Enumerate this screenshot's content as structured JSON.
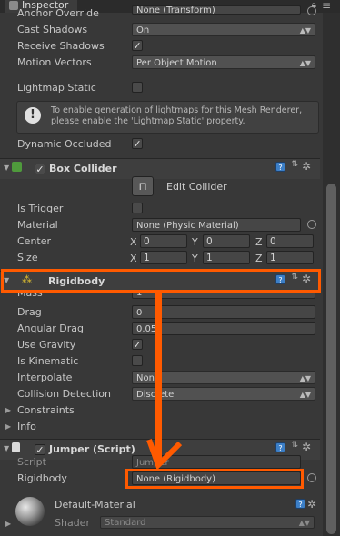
{
  "window": {
    "tab_label": "Inspector"
  },
  "mesh_renderer": {
    "anchor_override": {
      "label": "Anchor Override",
      "value": "None (Transform)"
    },
    "cast_shadows": {
      "label": "Cast Shadows",
      "value": "On"
    },
    "receive_shadows": {
      "label": "Receive Shadows",
      "checked": true
    },
    "motion_vectors": {
      "label": "Motion Vectors",
      "value": "Per Object Motion"
    },
    "lightmap_static": {
      "label": "Lightmap Static",
      "checked": false
    },
    "info_message": "To enable generation of lightmaps for this Mesh Renderer, please enable the 'Lightmap Static' property.",
    "dynamic_occluded": {
      "label": "Dynamic Occluded",
      "checked": true
    }
  },
  "box_collider": {
    "title": "Box Collider",
    "edit_collider_label": "Edit Collider",
    "is_trigger": {
      "label": "Is Trigger",
      "checked": false
    },
    "material": {
      "label": "Material",
      "value": "None (Physic Material)"
    },
    "center": {
      "label": "Center",
      "x": "0",
      "y": "0",
      "z": "0"
    },
    "size": {
      "label": "Size",
      "x": "1",
      "y": "1",
      "z": "1"
    }
  },
  "rigidbody": {
    "title": "Rigidbody",
    "mass": {
      "label": "Mass",
      "value": "1"
    },
    "drag": {
      "label": "Drag",
      "value": "0"
    },
    "angular_drag": {
      "label": "Angular Drag",
      "value": "0.05"
    },
    "use_gravity": {
      "label": "Use Gravity",
      "checked": true
    },
    "is_kinematic": {
      "label": "Is Kinematic",
      "checked": false
    },
    "interpolate": {
      "label": "Interpolate",
      "value": "None"
    },
    "collision_detection": {
      "label": "Collision Detection",
      "value": "Discrete"
    },
    "constraints_label": "Constraints",
    "info_label": "Info"
  },
  "jumper_script": {
    "title": "Jumper (Script)",
    "script": {
      "label": "Script",
      "value": "Jumper"
    },
    "rigidbody": {
      "label": "Rigidbody",
      "value": "None (Rigidbody)"
    }
  },
  "material": {
    "name": "Default-Material",
    "shader_label": "Shader",
    "shader_value": "Standard"
  },
  "axis_labels": {
    "x": "X",
    "y": "Y",
    "z": "Z"
  },
  "symbols": {
    "check": "✓",
    "warning": "!",
    "help": "?",
    "gear": "✲",
    "fold_open": "▼",
    "fold_closed": "▶",
    "dropdown": "▲▼",
    "edit_collider": "⊓"
  },
  "colors": {
    "annotation": "#ff5a00",
    "background": "#383838"
  }
}
